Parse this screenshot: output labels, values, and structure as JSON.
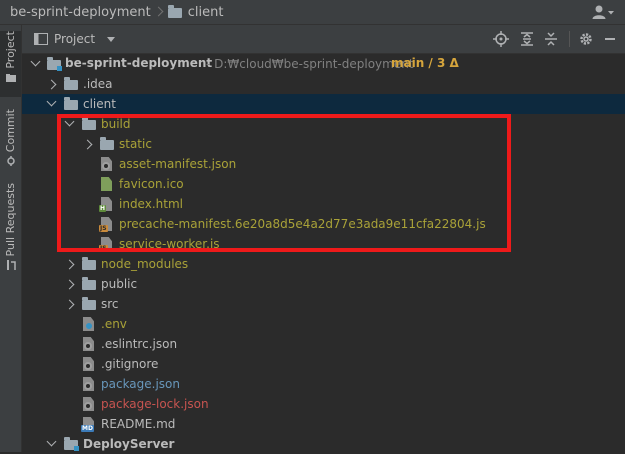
{
  "navbar": {
    "project": "be-sprint-deployment",
    "folder": "client",
    "user_icon": "user-icon"
  },
  "toolstrip": {
    "tabs": [
      {
        "label": "Project",
        "icon": "folder-icon",
        "active": true
      },
      {
        "label": "Commit",
        "icon": "commit-icon",
        "active": false
      },
      {
        "label": "Pull Requests",
        "icon": "pull-request-icon",
        "active": false
      }
    ]
  },
  "panel": {
    "title": "Project",
    "tools": [
      "locate-icon",
      "expand-all-icon",
      "collapse-all-icon",
      "settings-icon",
      "hide-icon"
    ]
  },
  "tree": {
    "root": {
      "name": "be-sprint-deployment",
      "path": "- D:₩cloud₩be-sprint-deployment",
      "branch": "main / 3 Δ"
    },
    "items": [
      {
        "name": ".idea"
      },
      {
        "name": "client"
      },
      {
        "name": "build"
      },
      {
        "name": "static"
      },
      {
        "name": "asset-manifest.json"
      },
      {
        "name": "favicon.ico"
      },
      {
        "name": "index.html"
      },
      {
        "name": "precache-manifest.6e20a8d5e4a2d77e3ada9e11cfa22804.js"
      },
      {
        "name": "service-worker.js"
      },
      {
        "name": "node_modules"
      },
      {
        "name": "public"
      },
      {
        "name": "src"
      },
      {
        "name": ".env"
      },
      {
        "name": ".eslintrc.json"
      },
      {
        "name": ".gitignore"
      },
      {
        "name": "package.json"
      },
      {
        "name": "package-lock.json"
      },
      {
        "name": "README.md"
      },
      {
        "name": "DeployServer"
      }
    ]
  },
  "colors": {
    "highlight_box": "#ee1a1a",
    "ignored_file": "#a9a238",
    "modified_file": "#6897bb",
    "changed_file": "#c75450",
    "branch": "#d6a53c"
  }
}
